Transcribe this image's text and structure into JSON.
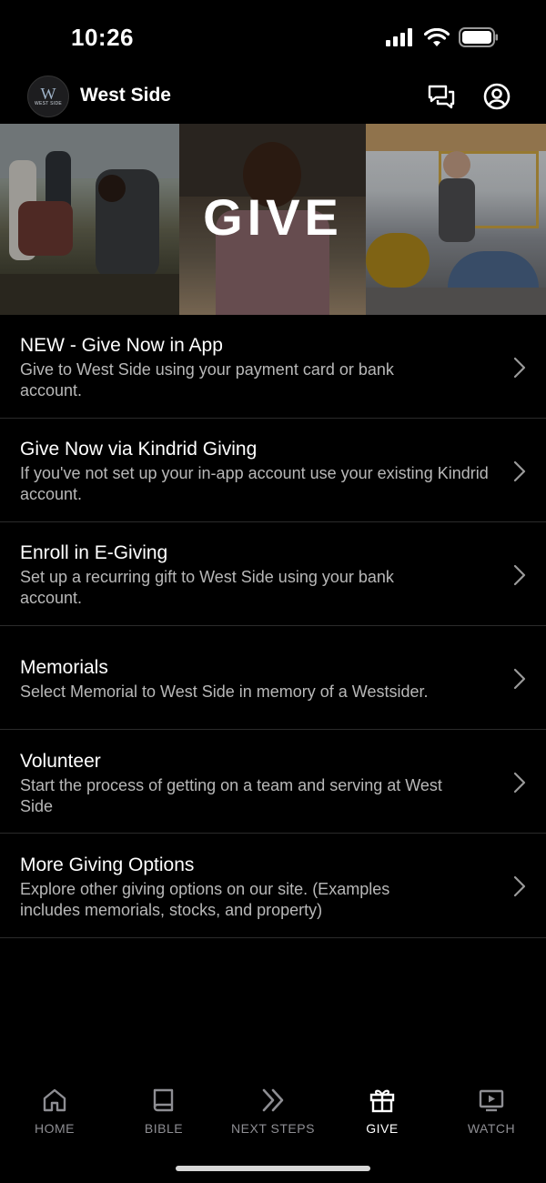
{
  "status_bar": {
    "time": "10:26"
  },
  "header": {
    "logo_text": "WEST SIDE",
    "logo_letter": "W",
    "title": "West Side"
  },
  "banner": {
    "title": "GIVE"
  },
  "items": [
    {
      "title": "NEW - Give Now in App",
      "description": "Give to West Side using your payment card or bank account."
    },
    {
      "title": "Give Now via Kindrid Giving",
      "description": "If you've not set up your in-app account use your existing Kindrid account."
    },
    {
      "title": "Enroll in E-Giving",
      "description": "Set up a recurring gift to West Side using your bank account."
    },
    {
      "title": "Memorials",
      "description": "Select Memorial to West Side in memory of a Westsider."
    },
    {
      "title": "Volunteer",
      "description": "Start the process of getting on a team and serving at West Side"
    },
    {
      "title": "More Giving Options",
      "description": "Explore other giving options on our site. (Examples includes memorials, stocks, and property)"
    }
  ],
  "tabs": [
    {
      "label": "HOME",
      "icon": "home-icon"
    },
    {
      "label": "BIBLE",
      "icon": "book-icon"
    },
    {
      "label": "NEXT STEPS",
      "icon": "double-chevron-icon"
    },
    {
      "label": "GIVE",
      "icon": "gift-icon",
      "active": true
    },
    {
      "label": "WATCH",
      "icon": "tv-play-icon"
    }
  ],
  "colors": {
    "background": "#000000",
    "inactive_tab": "#8e8e93",
    "description_text": "#b8b8b8"
  }
}
